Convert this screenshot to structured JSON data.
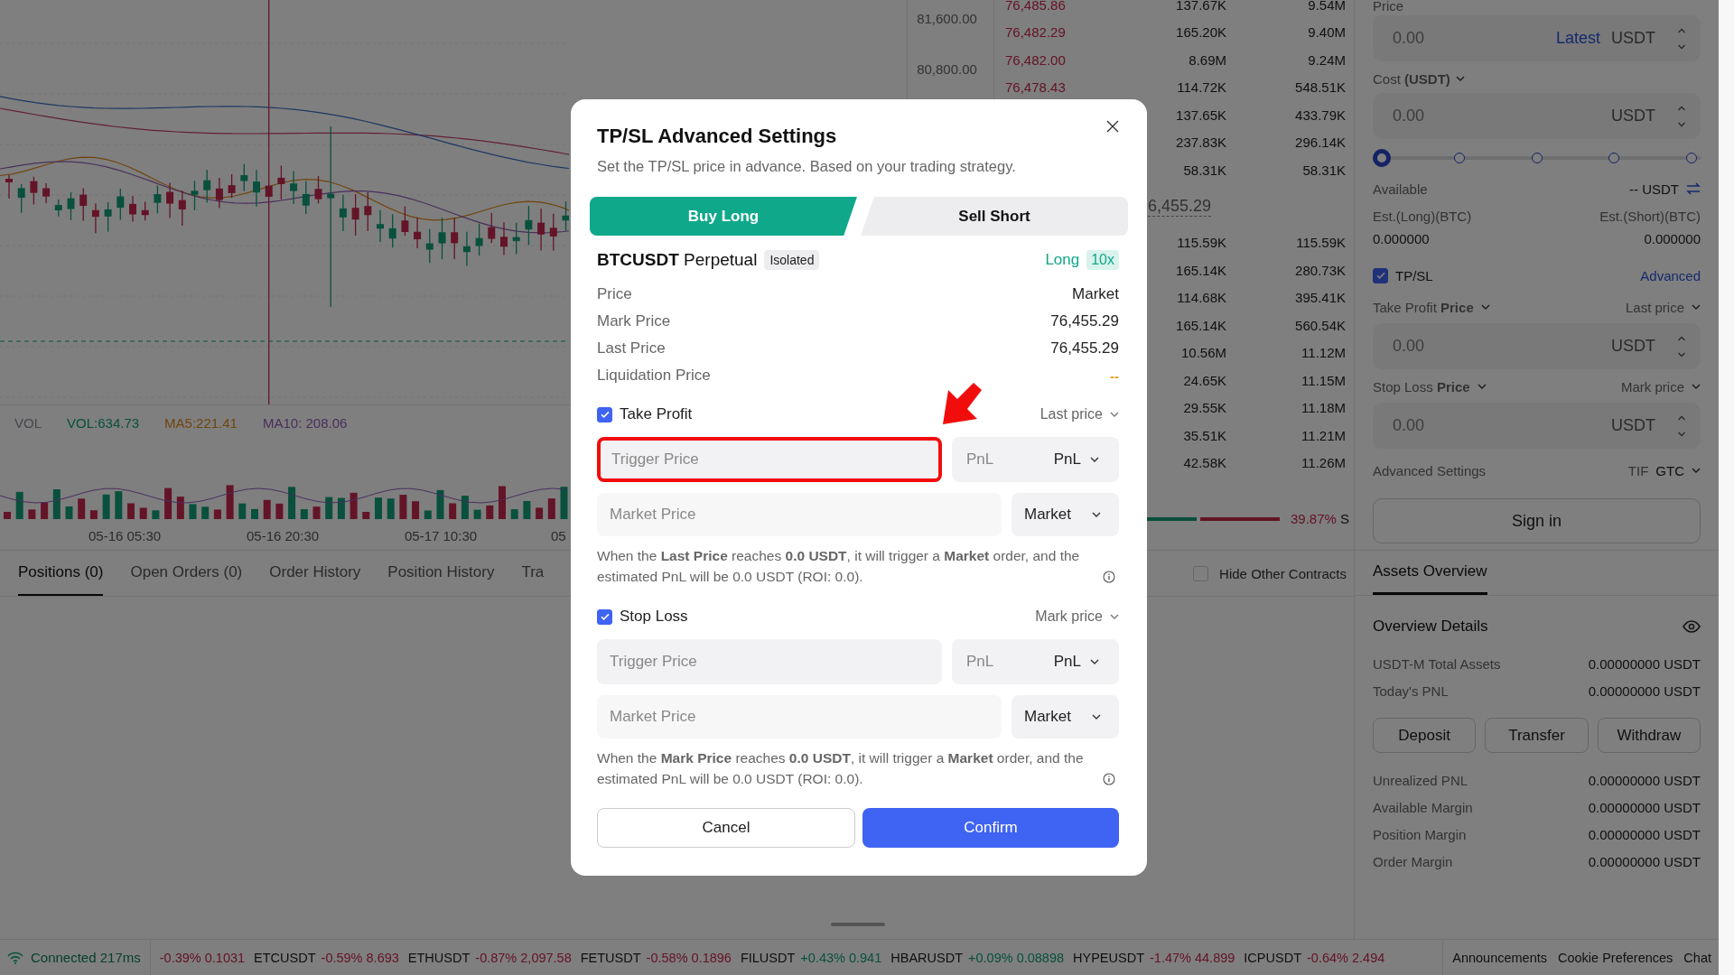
{
  "chart": {
    "price_ticks": [
      "81,600.00",
      "80,800.00"
    ],
    "legend": [
      "VOL",
      "VOL:634.73",
      "MA5:221.41",
      "MA10: 208.06"
    ],
    "time_ticks": [
      "05-16 05:30",
      "05-16 20:30",
      "05-17 10:30",
      "05"
    ]
  },
  "order_book": {
    "asks": [
      {
        "price": "76,485.86",
        "size": "137.67K",
        "total": "9.54M"
      },
      {
        "price": "76,482.29",
        "size": "165.20K",
        "total": "9.40M"
      },
      {
        "price": "76,482.00",
        "size": "8.69M",
        "total": "9.24M"
      },
      {
        "price": "76,478.43",
        "size": "114.72K",
        "total": "548.51K"
      },
      {
        "size": "137.65K",
        "total": "433.79K"
      },
      {
        "size": "237.83K",
        "total": "296.14K"
      },
      {
        "size": "58.31K",
        "total": "58.31K"
      }
    ],
    "mid_price": "6,455.29",
    "bids": [
      {
        "size": "115.59K",
        "total": "115.59K"
      },
      {
        "size": "165.14K",
        "total": "280.73K"
      },
      {
        "size": "114.68K",
        "total": "395.41K"
      },
      {
        "size": "165.14K",
        "total": "560.54K"
      },
      {
        "size": "10.56M",
        "total": "11.12M"
      },
      {
        "size": "24.65K",
        "total": "11.15M"
      },
      {
        "size": "29.55K",
        "total": "11.18M"
      },
      {
        "size": "35.51K",
        "total": "11.21M"
      },
      {
        "size": "42.58K",
        "total": "11.26M"
      }
    ],
    "ratio": {
      "value": "39.87%",
      "side": "S"
    }
  },
  "bottom_tabs": [
    {
      "label": "Positions (0)",
      "selected": true
    },
    {
      "label": "Open Orders (0)",
      "selected": false
    },
    {
      "label": "Order History",
      "selected": false
    },
    {
      "label": "Position History",
      "selected": false
    },
    {
      "label": "Tra",
      "selected": false
    }
  ],
  "hide_other_contracts": {
    "label": "Hide Other Contracts",
    "checked": false
  },
  "order_form": {
    "price_label": "Price",
    "price_field": {
      "placeholder": "0.00",
      "link": "Latest",
      "unit": "USDT"
    },
    "cost_label": "Cost **(USDT)**",
    "cost_field": {
      "placeholder": "0.00",
      "unit": "USDT"
    },
    "slider": {
      "level": 0
    },
    "available": {
      "label": "Available",
      "value": "-- USDT"
    },
    "estimates": [
      {
        "label": "Est.(Long)(BTC)",
        "value": "0.000000"
      },
      {
        "label": "Est.(Short)(BTC)",
        "value": "0.000000"
      }
    ],
    "tpsl": {
      "label": "TP/SL",
      "checked": true,
      "link": "Advanced"
    },
    "take_profit": {
      "label": "Take Profit **Price**",
      "trigger": "Last price",
      "field": {
        "placeholder": "0.00",
        "unit": "USDT"
      }
    },
    "stop_loss": {
      "label": "Stop Loss **Price**",
      "trigger": "Mark price",
      "field": {
        "placeholder": "0.00",
        "unit": "USDT"
      }
    },
    "advanced": {
      "label": "Advanced Settings",
      "tif_label": "TIF",
      "tif": "GTC"
    },
    "sign_in": "Sign in"
  },
  "assets": {
    "tab": {
      "label": "Assets Overview",
      "selected": true
    },
    "title": "Overview Details",
    "rows_top": [
      {
        "label": "USDT-M Total Assets",
        "value": "0.00000000 USDT"
      },
      {
        "label": "Today's PNL",
        "value": "0.00000000 USDT"
      }
    ],
    "buttons": [
      "Deposit",
      "Transfer",
      "Withdraw"
    ],
    "rows_bottom": [
      {
        "label": "Unrealized PNL",
        "value": "0.00000000 USDT"
      },
      {
        "label": "Available Margin",
        "value": "0.00000000 USDT"
      },
      {
        "label": "Position Margin",
        "value": "0.00000000 USDT"
      },
      {
        "label": "Order Margin",
        "value": "0.00000000 USDT"
      }
    ]
  },
  "footer": {
    "connection": "Connected 217ms",
    "ticker": [
      {
        "change": "-0.39%",
        "price": "0.1031",
        "up": false
      },
      {
        "symbol": "ETCUSDT",
        "change": "-0.59%",
        "price": "8.693",
        "up": false
      },
      {
        "symbol": "ETHUSDT",
        "change": "-0.87%",
        "price": "2,097.58",
        "up": false
      },
      {
        "symbol": "FETUSDT",
        "change": "-0.58%",
        "price": "0.1896",
        "up": false
      },
      {
        "symbol": "FILUSDT",
        "change": "+0.43%",
        "price": "0.941",
        "up": true
      },
      {
        "symbol": "HBARUSDT",
        "change": "+0.09%",
        "price": "0.08898",
        "up": true
      },
      {
        "symbol": "HYPEUSDT",
        "change": "-1.47%",
        "price": "44.899",
        "up": false
      },
      {
        "symbol": "ICPUSDT",
        "change": "-0.64%",
        "price": "2.494",
        "up": false
      }
    ],
    "links": [
      "Announcements",
      "Cookie Preferences",
      "Chat"
    ]
  },
  "modal": {
    "title": "TP/SL Advanced Settings",
    "subtitle": "Set the TP/SL price in advance. Based on your trading strategy.",
    "sides": [
      {
        "label": "Buy Long",
        "selected": true
      },
      {
        "label": "Sell Short",
        "selected": false
      }
    ],
    "symbol": "**BTCUSDT** Perpetual",
    "margin_badge": "Isolated",
    "direction": "Long",
    "leverage": "10x",
    "info": [
      {
        "label": "Price",
        "value": "Market",
        "kind": "plain"
      },
      {
        "label": "Mark Price",
        "value": "76,455.29",
        "kind": "plain"
      },
      {
        "label": "Last Price",
        "value": "76,455.29",
        "kind": "plain"
      },
      {
        "label": "Liquidation Price",
        "value": "--",
        "kind": "warning"
      }
    ],
    "sections": [
      {
        "label": "Take Profit",
        "checked": true,
        "trigger": "Last price",
        "trigger_field": {
          "placeholder": "Trigger Price",
          "highlighted": true
        },
        "pnl_field": {
          "placeholder": "PnL"
        },
        "pnl_select": "PnL",
        "market_field": {
          "placeholder": "Market Price"
        },
        "order_type": "Market",
        "note": "When the **Last Price** reaches **0.0 USDT**, it will trigger a **Market** order, and the estimated PnL will be 0.0 USDT (ROI: 0.0)."
      },
      {
        "label": "Stop Loss",
        "checked": true,
        "trigger": "Mark price",
        "trigger_field": {
          "placeholder": "Trigger Price",
          "highlighted": false
        },
        "pnl_field": {
          "placeholder": "PnL"
        },
        "pnl_select": "PnL",
        "market_field": {
          "placeholder": "Market Price"
        },
        "order_type": "Market",
        "note": "When the **Mark Price** reaches **0.0 USDT**, it will trigger a **Market** order, and the estimated PnL will be 0.0 USDT (ROI: 0.0)."
      }
    ],
    "buttons": [
      {
        "label": "Cancel",
        "kind": "secondary"
      },
      {
        "label": "Confirm",
        "kind": "primary"
      }
    ]
  }
}
